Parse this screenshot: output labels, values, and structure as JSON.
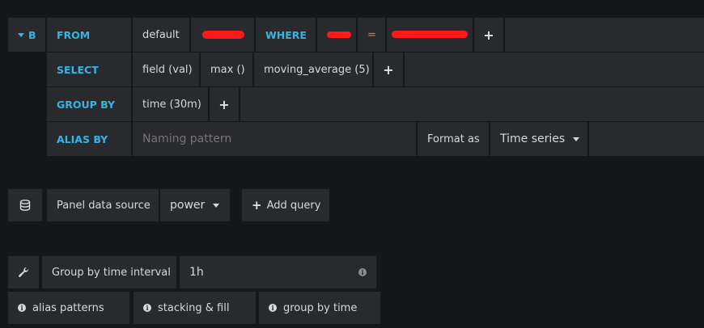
{
  "query": {
    "ref_id": "B",
    "from": {
      "keyword": "FROM",
      "policy": "default",
      "measurement": "",
      "where_keyword": "WHERE",
      "where_key": "",
      "where_operator": "=",
      "where_value": ""
    },
    "select": {
      "keyword": "SELECT",
      "parts": [
        "field (val)",
        "max ()",
        "moving_average (5)"
      ]
    },
    "group_by": {
      "keyword": "GROUP BY",
      "parts": [
        "time (30m)"
      ]
    },
    "alias_by": {
      "keyword": "ALIAS BY",
      "placeholder": "Naming pattern",
      "format_label": "Format as",
      "format_value": "Time series"
    },
    "add_symbol": "+"
  },
  "datasource": {
    "label": "Panel data source",
    "value": "power",
    "add_query_label": "Add query"
  },
  "options": {
    "interval_label": "Group by time interval",
    "interval_value": "1h",
    "help_buttons": [
      "alias patterns",
      "stacking & fill",
      "group by time"
    ]
  },
  "colors": {
    "background": "#161719",
    "cell": "#292a2d",
    "keyword": "#33b5e5",
    "operator": "#eb7b18",
    "redaction": "#ff1a1a"
  },
  "icons": {
    "collapse": "caret-down-icon",
    "database": "database-icon",
    "wrench": "wrench-icon",
    "info": "info-circle-icon",
    "plus": "plus-icon"
  }
}
